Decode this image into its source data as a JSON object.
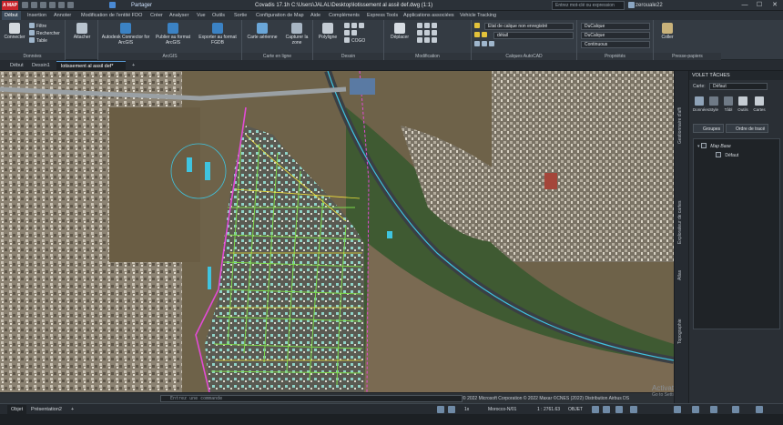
{
  "app": {
    "logo_text": "A MAP",
    "share_label": "Partager",
    "window_title": "Covadis 17.1h    C:\\Users\\JALAL\\Desktop\\lotissement al assil def.dwg (1:1)",
    "search_placeholder": "Entrez mot-clé ou expression",
    "user_name": "zerouale22",
    "win_minimize": "—",
    "win_maximize": "☐",
    "win_close": "✕"
  },
  "menu_tabs": [
    "Début",
    "Insertion",
    "Annoter",
    "Modification de l'entité FDO",
    "Créer",
    "Analyser",
    "Vue",
    "Outils",
    "Sortie",
    "Configuration de Map",
    "Aide",
    "Compléments",
    "Express Tools",
    "Applications associées",
    "Vehicle Tracking"
  ],
  "ribbon": {
    "connect": "Connecter",
    "filter": "Filtre",
    "search": "Rechercher",
    "table": "Table",
    "attach": "Attacher",
    "arcgis_connector": "Autodesk Connector for ArcGIS",
    "publish_arcgis": "Publier au format ArcGIS",
    "export_fgdb": "Exporter au format FGDB",
    "aerial_map": "Carte aérienne",
    "capture_zone": "Capturer la zone",
    "polyline": "Polyligne",
    "cogo": "COGO",
    "move": "Déplacer",
    "paste": "Coller",
    "layer_state": "Etat de calque non enregistré",
    "layer_name": "détail",
    "color_value": "DuCalque",
    "linetype_value": "DuCalque",
    "lineweight_value": "Continuous",
    "groups": {
      "data": "Données",
      "arcgis": "ArcGIS",
      "online_map": "Carte en ligne",
      "draw": "Dessin",
      "modify": "Modification",
      "autocad_layers": "Calques AutoCAD",
      "properties": "Propriétés",
      "clipboard": "Presse-papiers"
    }
  },
  "doc_tabs": [
    "Début",
    "Dessin1",
    "lotissement al assil def*"
  ],
  "doc_tab_add": "+",
  "task_pane": {
    "header": "VOLET TÂCHES",
    "map_label": "Carte:",
    "map_value": "Défaut",
    "vertical_tabs": [
      "Gestionnaire d'affi",
      "Explorateur de cartes",
      "Atlas",
      "Topographie"
    ],
    "icons": [
      "Données",
      "Style",
      "Tâbl",
      "Outils",
      "Cartes"
    ],
    "groups_button": "Groupes",
    "draw_order_button": "Ordre de tracé",
    "tree": [
      {
        "label": "Map Base",
        "checked": true
      },
      {
        "label": "Défaut",
        "checked": false
      }
    ]
  },
  "command": {
    "placeholder": "Entrez une commande",
    "copyright": "© 2022 Microsoft Corporation  © 2022 Maxar ©CNES (2022) Distribution Airbus DS"
  },
  "watermark": {
    "title": "Activate Windows",
    "sub": "Go to Settings to activate Windows."
  },
  "status": {
    "tabs": [
      "Objet",
      "Présentation2"
    ],
    "tab_add": "+",
    "coord_system": "Morocco-N/01",
    "scale": "1 : 2761.63",
    "mode": "OBJET",
    "zoom_value": "1x"
  },
  "colors": {
    "accent": "#5b9bd5",
    "ribbon_bg": "#343b43",
    "panel_bg": "#2a2f35",
    "parcel_green": "#7cd94a",
    "parcel_yellow": "#f2e33a",
    "road_magenta": "#e24bd6",
    "road_cyan": "#3fc4e0"
  }
}
